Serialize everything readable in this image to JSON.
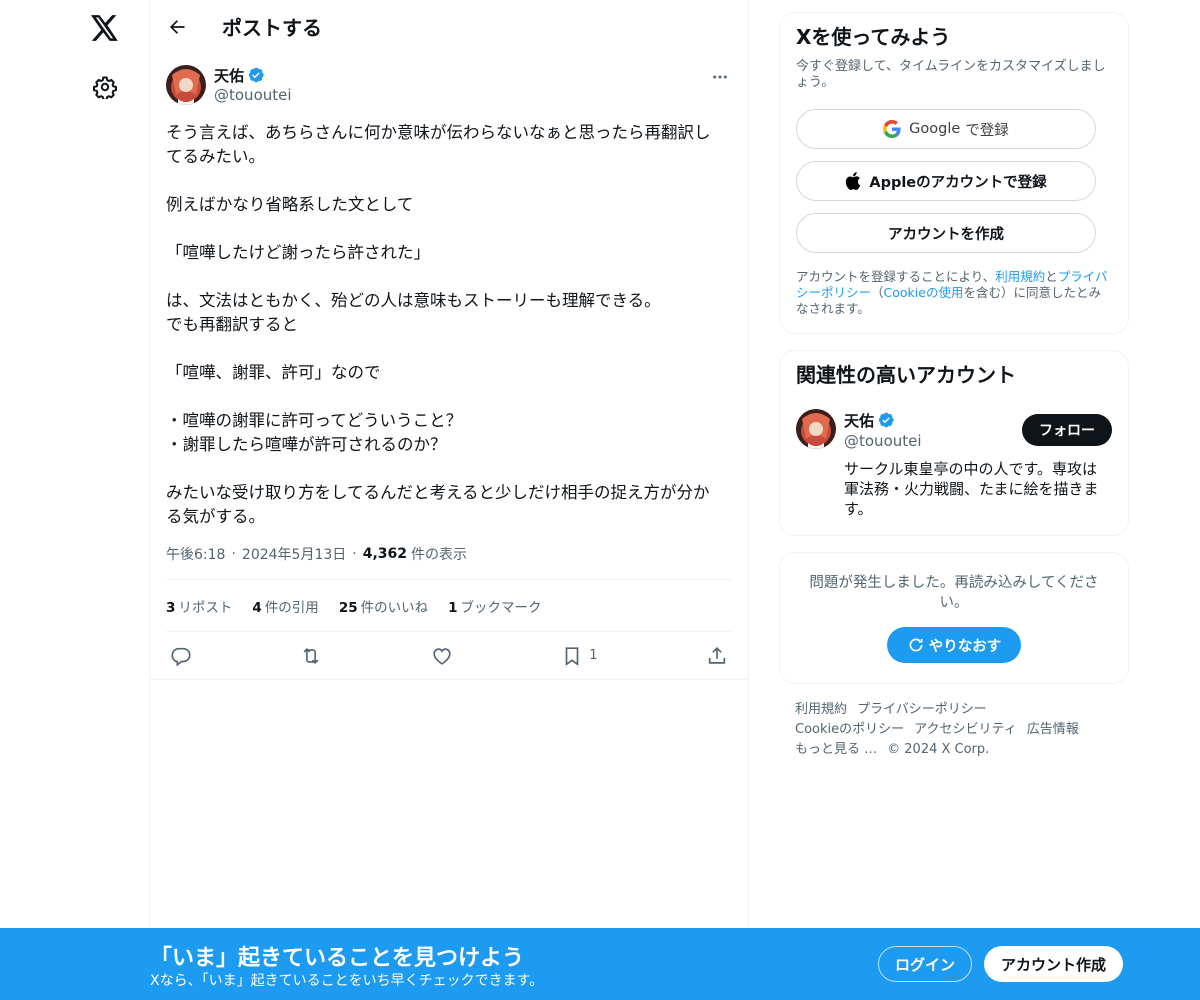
{
  "nav": {
    "logo_icon": "x-logo-icon",
    "settings_icon": "gear-icon"
  },
  "header": {
    "title": "ポストする"
  },
  "post": {
    "author_name": "天佑",
    "author_handle": "@tououtei",
    "body": "そう言えば、あちらさんに何か意味が伝わらないなぁと思ったら再翻訳し\nてるみたい。\n\n例えばかなり省略系した文として\n\n「喧嘩したけど謝ったら許された」\n\nは、文法はともかく、殆どの人は意味もストーリーも理解できる。\nでも再翻訳すると\n\n「喧嘩、謝罪、許可」なので\n\n・喧嘩の謝罪に許可ってどういうこと？\n・謝罪したら喧嘩が許可されるのか？\n\nみたいな受け取り方をしてるんだと考えると少しだけ相手の捉え方が分か\nる気がする。",
    "time": "午後6:18",
    "date": "2024年5月13日",
    "views_count": "4,362",
    "views_label": "件の表示",
    "stats": {
      "reposts_count": "3",
      "reposts_label": "リポスト",
      "quotes_count": "4",
      "quotes_label": "件の引用",
      "likes_count": "25",
      "likes_label": "件のいいね",
      "bookmarks_count": "1",
      "bookmarks_label": "ブックマーク"
    },
    "bookmark_action_count": "1"
  },
  "signup_card": {
    "title": "Xを使ってみよう",
    "subtitle": "今すぐ登録して、タイムラインをカスタマイズしましょう。",
    "google_brand": "Google",
    "google_suffix": "で登録",
    "apple_label": "Appleのアカウントで登録",
    "create_label": "アカウントを作成",
    "legal_prefix": "アカウントを登録することにより、",
    "legal_terms": "利用規約",
    "legal_and": "と",
    "legal_privacy": "プライバシーポリシー",
    "legal_paren_open": "（",
    "legal_cookie": "Cookieの使用",
    "legal_paren_close": "を含む）に同意したとみなされます。"
  },
  "related_card": {
    "title": "関連性の高いアカウント",
    "name": "天佑",
    "handle": "@tououtei",
    "bio": "サークル東皇亭の中の人です。専攻は軍法務・火力戦闘、たまに絵を描きます。",
    "follow_label": "フォロー"
  },
  "error_card": {
    "message": "問題が発生しました。再読み込みしてください。",
    "retry_label": "やりなおす"
  },
  "footer": {
    "terms": "利用規約",
    "privacy": "プライバシーポリシー",
    "cookie": "Cookieのポリシー",
    "accessibility": "アクセシビリティ",
    "ads": "広告情報",
    "more": "もっと見る …",
    "copyright": "© 2024 X Corp."
  },
  "banner": {
    "title": "「いま」起きていることを見つけよう",
    "subtitle": "Xなら、「いま」起きていることをいち早くチェックできます。",
    "login_label": "ログイン",
    "create_label": "アカウント作成"
  },
  "colors": {
    "accent": "#1d9bf0",
    "text": "#0f1419",
    "muted": "#536471",
    "border": "#eff3f4"
  }
}
